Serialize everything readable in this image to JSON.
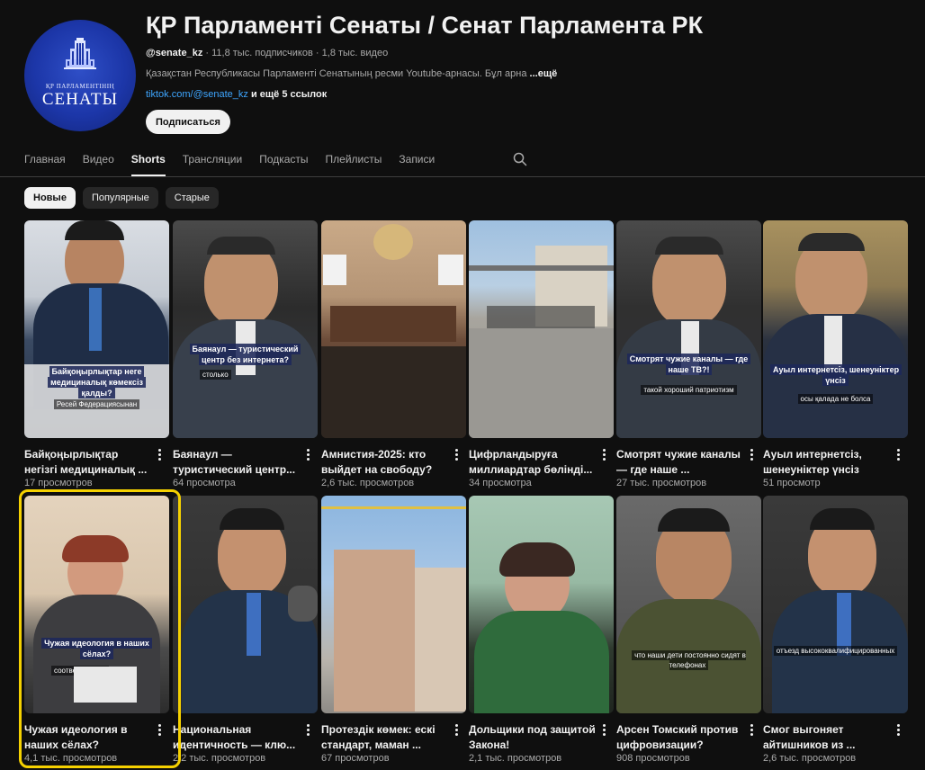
{
  "channel": {
    "title": "ҚР Парламенті Сенаты / Сенат Парламента РК",
    "handle": "@senate_kz",
    "subscribers": "11,8 тыс. подписчиков",
    "videos": "1,8 тыс. видео",
    "description": "Қазақстан Республикасы Парламенті Сенатының ресми Youtube-арнасы. Бұл арна",
    "description_more": "...ещё",
    "link": "tiktok.com/@senate_kz",
    "link_rest": "и ещё 5 ссылок",
    "subscribe_label": "Подписаться",
    "logo_line1": "ҚР ПАРЛАМЕНТІНІҢ",
    "logo_line2": "СЕНАТЫ"
  },
  "tabs": [
    {
      "label": "Главная"
    },
    {
      "label": "Видео"
    },
    {
      "label": "Shorts",
      "active": true
    },
    {
      "label": "Трансляции"
    },
    {
      "label": "Подкасты"
    },
    {
      "label": "Плейлисты"
    },
    {
      "label": "Записи"
    }
  ],
  "chips": [
    {
      "label": "Новые",
      "active": true
    },
    {
      "label": "Популярные"
    },
    {
      "label": "Старые"
    }
  ],
  "shorts": [
    {
      "title": "Байқоңырлықтар негізгі медициналық ...",
      "views": "17 просмотров",
      "caption": "Байқоңырлықтар неге медициналық көмексіз қалды?",
      "subcaption": "Ресей Федерациясынан"
    },
    {
      "title": "Баянаул — туристический центр...",
      "views": "64 просмотра",
      "caption": "Баянаул — туристический центр без интернета?",
      "subcaption": "столько"
    },
    {
      "title": "Амнистия-2025: кто выйдет на свободу?",
      "views": "2,6 тыс. просмотров",
      "caption": "",
      "subcaption": ""
    },
    {
      "title": "Цифрландыруға миллиардтар бөлінді...",
      "views": "34 просмотра",
      "caption": "",
      "subcaption": ""
    },
    {
      "title": "Смотрят чужие каналы — где наше ...",
      "views": "27 тыс. просмотров",
      "caption": "Смотрят чужие каналы — где наше ТВ?!",
      "subcaption": "такой хороший патриотизм"
    },
    {
      "title": "Ауыл интернетсіз, шенеуніктер үнсіз",
      "views": "51 просмотр",
      "caption": "Ауыл интернетсіз, шенеуніктер үнсіз",
      "subcaption": "осы қалада не болса"
    },
    {
      "title": "Чужая идеология в наших сёлах?",
      "views": "4,1 тыс. просмотров",
      "caption": "Чужая идеология в наших сёлах?",
      "subcaption": "соответственно"
    },
    {
      "title": "Национальная идентичность — клю...",
      "views": "2,2 тыс. просмотров",
      "caption": "",
      "subcaption": ""
    },
    {
      "title": "Протездік көмек: ескі стандарт, маман ...",
      "views": "67 просмотров",
      "caption": "",
      "subcaption": ""
    },
    {
      "title": "Дольщики под защитой Закона!",
      "views": "2,1 тыс. просмотров",
      "caption": "",
      "subcaption": ""
    },
    {
      "title": "Арсен Томский против цифровизации?",
      "views": "908 просмотров",
      "caption": "",
      "subcaption": "что наши дети постоянно сидят в телефонах"
    },
    {
      "title": "Смог выгоняет айтишников из ...",
      "views": "2,6 тыс. просмотров",
      "caption": "",
      "subcaption": "отъезд высококвалифицированных"
    }
  ],
  "colors": {
    "background": "#0f0f0f",
    "highlight": "#f5d100",
    "link": "#3ea6ff"
  }
}
